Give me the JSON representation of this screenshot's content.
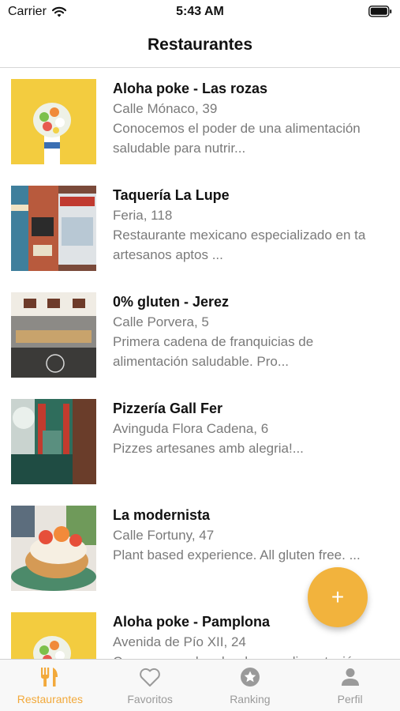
{
  "status_bar": {
    "carrier": "Carrier",
    "time": "5:43 AM"
  },
  "nav": {
    "title": "Restaurantes"
  },
  "restaurants": [
    {
      "name": "Aloha poke - Las rozas",
      "address": "Calle Mónaco, 39",
      "description": [
        "Conocemos el poder de una alimentación",
        "saludable para nutrir..."
      ]
    },
    {
      "name": "Taquería La Lupe",
      "address": "Feria, 118",
      "description": [
        "Restaurante mexicano especializado en ta",
        "artesanos aptos ..."
      ]
    },
    {
      "name": "0% gluten - Jerez",
      "address": "Calle Porvera, 5",
      "description": [
        "Primera cadena de franquicias de",
        "alimentación saludable. Pro..."
      ]
    },
    {
      "name": "Pizzería Gall Fer",
      "address": "Avinguda Flora Cadena, 6",
      "description": [
        "Pizzes artesanes amb alegria!..."
      ]
    },
    {
      "name": "La modernista",
      "address": "Calle Fortuny, 47",
      "description": [
        "Plant based experience. All gluten free. ..."
      ]
    },
    {
      "name": "Aloha poke - Pamplona",
      "address": "Avenida de Pío XII, 24",
      "description": [
        "Conocemos el poder de una alimentación"
      ]
    }
  ],
  "fab": {
    "label": "+",
    "color": "#f2b33d"
  },
  "tabs": [
    {
      "label": "Restaurantes",
      "icon": "fork-knife-icon",
      "active": true
    },
    {
      "label": "Favoritos",
      "icon": "heart-icon",
      "active": false
    },
    {
      "label": "Ranking",
      "icon": "star-icon",
      "active": false
    },
    {
      "label": "Perfil",
      "icon": "person-icon",
      "active": false
    }
  ],
  "colors": {
    "accent": "#f2a93b",
    "secondary_text": "#7a7a7a",
    "inactive_tab": "#9a9a9a"
  }
}
